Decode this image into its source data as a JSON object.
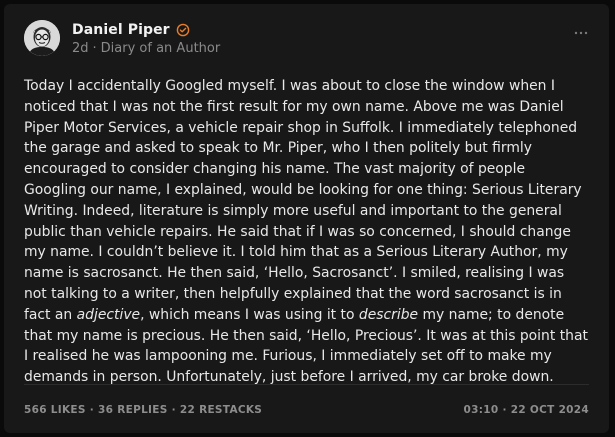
{
  "post": {
    "author": {
      "name": "Daniel Piper",
      "verified_color": "#e87d2a"
    },
    "meta": {
      "age": "2d",
      "separator": "·",
      "publication": "Diary of an Author"
    },
    "menu_icon": "more-horizontal-icon",
    "body": {
      "p1": "Today I accidentally Googled myself. I was about to close the window when I noticed that I was not the first result for my own name. Above me was Daniel Piper Motor Services, a vehicle repair shop in Suffolk. I immediately telephoned the garage and asked to speak to Mr. Piper, who I then politely but firmly encouraged to consider changing his name. The vast majority of people Googling our name, I explained, would be looking for one thing: Serious Literary Writing. Indeed, literature is simply more useful and important to the general public than vehicle repairs. He said that if I was so concerned, I should change my name. I couldn’t believe it. I told him that as a Serious Literary Author, my name is sacrosanct. He then said, ‘Hello, Sacrosanct’. I smiled, realising I was not talking to a writer, then helpfully explained that the word sacrosanct is in fact an ",
      "em1": "adjective",
      "p2": ", which means I was using it to ",
      "em2": "describe",
      "p3": " my name; to denote that my name is precious. He then said, ‘Hello, Precious’. It was at this point that I realised he was lampooning me. Furious, I immediately set off to make my demands in person. Unfortunately, just before I arrived, my car broke down."
    },
    "stats": {
      "likes": "566 LIKES",
      "replies": "36 REPLIES",
      "restacks": "22 RESTACKS",
      "separator": "·"
    },
    "timestamp": {
      "time": "03:10",
      "separator": "·",
      "date": "22 OCT 2024"
    }
  },
  "colors": {
    "background": "#0a0a0a",
    "card": "#181818",
    "text": "#e8e8e8",
    "muted": "#8a8a8a",
    "accent": "#e87d2a"
  }
}
